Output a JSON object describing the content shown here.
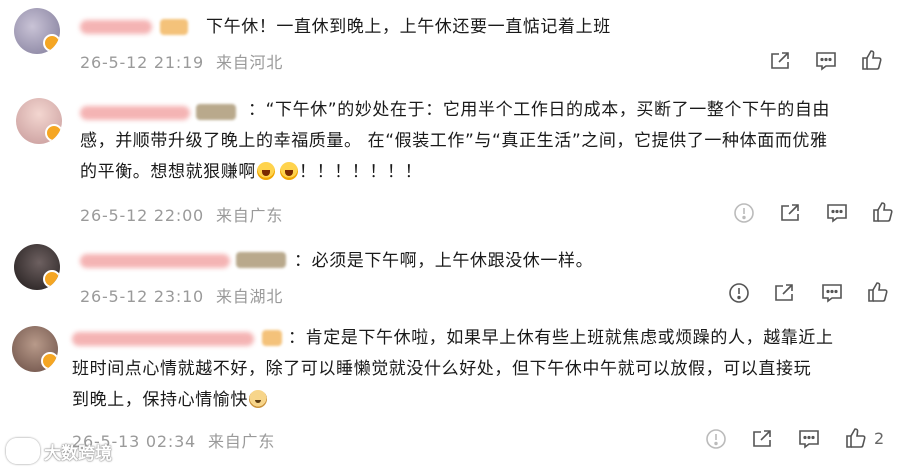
{
  "comments": [
    {
      "text_lines": [
        "下午休！一直休到晚上，上午休还要一直惦记着上班"
      ],
      "date": "26-5-12 21:19",
      "location": "来自河北",
      "actions": [
        "share-icon",
        "comment-icon",
        "like-icon"
      ]
    },
    {
      "text_lines": [
        "：“下午休”的妙处在于：它用半个工作日的成本，买断了一整个下午的自由",
        "感，并顺带升级了晚上的幸福质量。 在“假装工作”与“真正生活”之间，它提供了一种体面而优雅",
        "的平衡。想想就狠赚啊",
        "！！！！！！！"
      ],
      "date": "26-5-12 22:00",
      "location": "来自广东",
      "actions": [
        "report-icon",
        "share-icon",
        "comment-icon",
        "like-icon"
      ]
    },
    {
      "text_lines": [
        "：必须是下午啊，上午休跟没休一样。"
      ],
      "date": "26-5-12 23:10",
      "location": "来自湖北",
      "actions": [
        "report-icon",
        "share-icon",
        "comment-icon",
        "like-icon"
      ]
    },
    {
      "text_lines": [
        "：肯定是下午休啦，如果早上休有些上班就焦虑或烦躁的人，越靠近上",
        "班时间点心情就越不好，除了可以睡懒觉就没什么好处，但下午休中午就可以放假，可以直接玩",
        "到晚上，保持心情愉快"
      ],
      "date": "26-5-13 02:34",
      "location": "来自广东",
      "like_count": "2",
      "actions": [
        "report-icon",
        "share-icon",
        "comment-icon",
        "like-icon"
      ]
    }
  ],
  "watermark": {
    "text": "大数跨境",
    "logo": "eye-logo-icon"
  },
  "colors": {
    "meta": "#9a9a9a",
    "username_blurred": "#f0a0a0",
    "icon": "#555555"
  },
  "emoji_names": [
    "laughing-face-emoji",
    "laughing-face-emoji",
    "dog-face-emoji"
  ]
}
